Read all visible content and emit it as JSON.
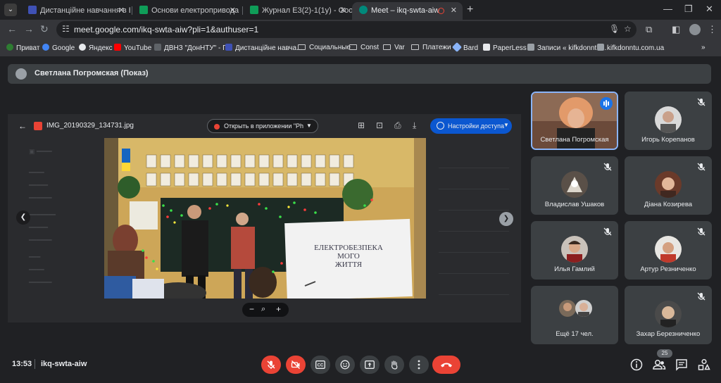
{
  "browser": {
    "tabs": [
      {
        "title": "Дистанційне навчання в ВСП",
        "favicon_color": "#3f51b5"
      },
      {
        "title": "Основи електропривода (+Вид",
        "favicon_color": "#0f9d58"
      },
      {
        "title": "Журнал Е3(2)-1(1у) - Google Т",
        "favicon_color": "#0f9d58"
      },
      {
        "title": "Meet – ikq-swta-aiw",
        "favicon_color": "#00897b"
      }
    ],
    "url": "meet.google.com/ikq-swta-aiw?pli=1&authuser=1",
    "bookmarks": [
      "Приват",
      "Google",
      "Яндекс",
      "YouTube",
      "ДВНЗ \"ДонНТУ\" - Г...",
      "Дистанційне навча...",
      "Социальные",
      "Const",
      "Var",
      "Платежи",
      "Bard",
      "PaperLess",
      "Записи « kifkdonntu...",
      "kifkdonntu.com.ua"
    ]
  },
  "meet": {
    "presenter_banner": "Светлана Погромская (Показ)",
    "viewer": {
      "filename": "IMG_20190329_134731.jpg",
      "open_in_app": "Открыть в приложении \"Ph",
      "access_settings": "Настройки доступа"
    },
    "photo_banner": [
      "ЕЛЕКТРОБЕЗПЕКА",
      "МОГО",
      "ЖИТТЯ"
    ],
    "participants": [
      {
        "name": "Светлана Погромская",
        "muted": false,
        "speaking": true
      },
      {
        "name": "Игорь Корепанов",
        "muted": true
      },
      {
        "name": "Владислав Ушаков",
        "muted": true
      },
      {
        "name": "Діана Козирева",
        "muted": true
      },
      {
        "name": "Илья Гамлий",
        "muted": true
      },
      {
        "name": "Артур Резниченко",
        "muted": true
      },
      {
        "name": "Ещё 17 чел.",
        "muted": true
      },
      {
        "name": "Захар Березниченко",
        "muted": true
      }
    ],
    "time": "13:53",
    "meeting_code": "ikq-swta-aiw",
    "people_count": "25",
    "colors": {
      "accent": "#8ab4f8",
      "danger": "#ea4335",
      "primary_button": "#0b57d0"
    }
  }
}
